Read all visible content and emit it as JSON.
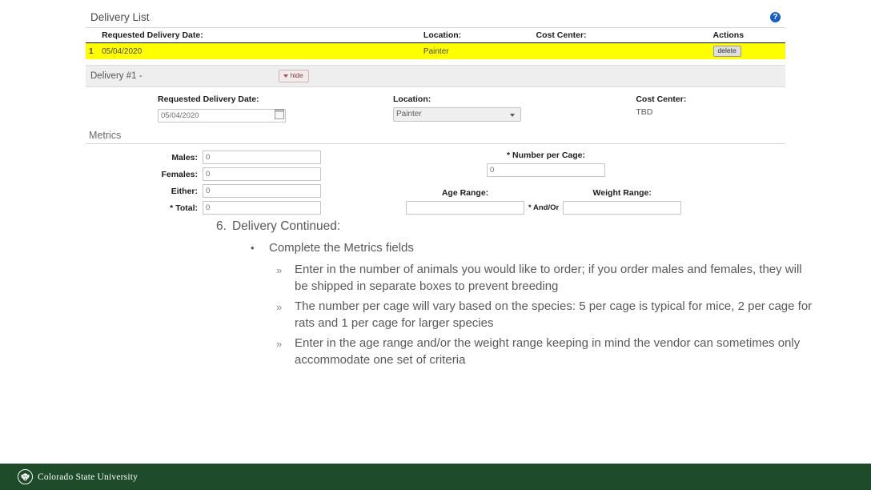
{
  "screenshot": {
    "panel_title": "Delivery List",
    "help_icon": "question-mark-icon",
    "table": {
      "headers": [
        "Requested Delivery Date:",
        "Location:",
        "Cost Center:",
        "Actions"
      ],
      "rows": [
        {
          "index": "1",
          "date": "05/04/2020",
          "location": "Painter",
          "cost_center": "",
          "action_label": "delete",
          "highlight_color": "#ffff00"
        }
      ]
    },
    "delivery_bar": {
      "label": "Delivery #1 -",
      "hide_label": "hide",
      "caret_icon": "caret-down-icon"
    },
    "delivery_fields": {
      "date_label": "Requested Delivery Date:",
      "date_value": "05/04/2020",
      "calendar_icon": "calendar-icon",
      "location_label": "Location:",
      "location_value": "Painter",
      "location_caret": "chevron-down-icon",
      "cost_center_label": "Cost Center:",
      "cost_center_value": "TBD"
    },
    "metrics": {
      "title": "Metrics",
      "fields": [
        {
          "label": "Males:",
          "value": "0",
          "required": false
        },
        {
          "label": "Females:",
          "value": "0",
          "required": false
        },
        {
          "label": "Either:",
          "value": "0",
          "required": false
        },
        {
          "label": "Total:",
          "value": "0",
          "required": true
        }
      ],
      "number_per_cage_label": "Number per Cage:",
      "number_per_cage_value": "0",
      "number_per_cage_required": true,
      "age_range_label": "Age Range:",
      "age_range_value": "",
      "and_or_label": "And/Or",
      "and_or_required": true,
      "weight_range_label": "Weight Range:",
      "weight_range_value": "",
      "required_marker": "*"
    }
  },
  "slide": {
    "step_number": "6.",
    "step_title": "Delivery Continued:",
    "bullet_marker": "•",
    "sub_marker": "»",
    "bullet": "Complete the Metrics fields",
    "sub_bullets": [
      "Enter in the number of animals you would like to order; if you order males and females, they will be shipped in separate boxes to prevent breeding",
      "The number per cage will vary based on the species: 5 per cage is typical for mice, 2 per cage for rats and 1 per cage for larger species",
      "Enter in the age range and/or the weight range keeping in mind the vendor can sometimes only accommodate one set of criteria"
    ]
  },
  "footer": {
    "logo_icon": "ram-logo-icon",
    "university_name": "Colorado State University",
    "bar_color": "#1e4c2b"
  }
}
